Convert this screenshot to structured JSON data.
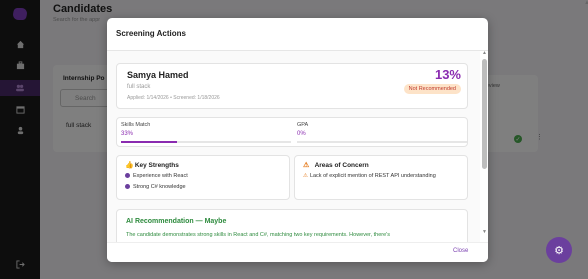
{
  "page": {
    "title": "Candidates",
    "subtitle": "Search for the appr"
  },
  "background": {
    "internship_header": "Internship Po",
    "search_placeholder": "Search",
    "row_role": "full stack",
    "review_header": "review"
  },
  "modal": {
    "title": "Screening Actions",
    "close_label": "Close",
    "candidate": {
      "name": "Samya Hamed",
      "role": "full stack",
      "applied": "Applied: 1/14/2026 • Screened: 1/18/2026",
      "score": "13%",
      "status": "Not Recommended"
    },
    "skills_match": {
      "label": "Skills Match",
      "value": "33%",
      "fraction": 0.33
    },
    "gpa": {
      "label": "GPA",
      "value": "0%",
      "fraction": 0.0
    },
    "strengths": {
      "title": "Key Strengths",
      "items": [
        "Experience with React",
        "Strong C# knowledge"
      ]
    },
    "concerns": {
      "title": "Areas of Concern",
      "items": [
        "Lack of explicit mention of REST API understanding"
      ]
    },
    "ai": {
      "title": "AI Recommendation — Maybe",
      "text": "The candidate demonstrates strong skills in React and C#, matching two key requirements. However, there's"
    }
  },
  "colors": {
    "accent": "#8a2bb0",
    "success": "#2e8b3e",
    "warning": "#e67e22",
    "sidebar": "#1a1a1a"
  },
  "icons": {
    "logo": "logo-icon",
    "home": "home-icon",
    "briefcase": "briefcase-icon",
    "users": "users-icon",
    "calendar": "calendar-icon",
    "person": "person-icon",
    "logout": "logout-icon",
    "settings": "gear-icon"
  }
}
